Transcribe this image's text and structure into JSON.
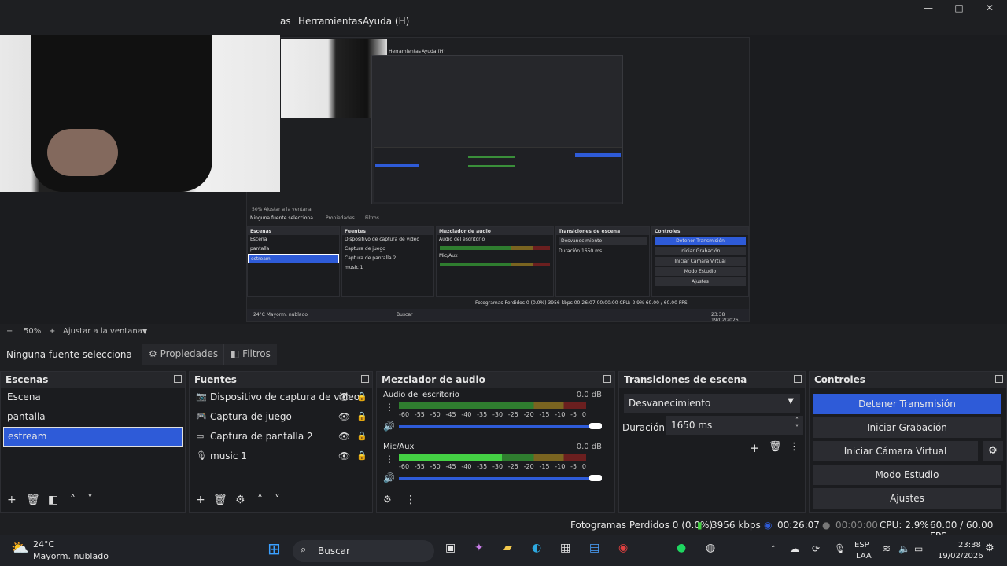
{
  "menu": {
    "items": [
      "as",
      "Herramientas",
      "Ayuda (H)"
    ]
  },
  "window_controls": {
    "minimize": "—",
    "maximize": "□",
    "close": "✕"
  },
  "preview": {
    "inner": {
      "menu": [
        "Herramientas",
        "Ayuda (H)"
      ],
      "status_left": "50%   Ajustar a la ventana",
      "no_source": "Ninguna fuente selecciona",
      "props": "Propiedades",
      "filters": "Filtros",
      "docks": {
        "scenes": {
          "title": "Escenas",
          "items": [
            "Escena",
            "pantalla",
            "estream"
          ]
        },
        "sources": {
          "title": "Fuentes",
          "items": [
            "Dispositivo de captura de video",
            "Captura de juego",
            "Captura de pantalla 2",
            "music 1"
          ]
        },
        "mixer": {
          "title": "Mezclador de audio",
          "ch1": "Audio del escritorio",
          "ch2": "Mic/Aux",
          "db": "0.0 dB"
        },
        "transitions": {
          "title": "Transiciones de escena",
          "value": "Desvanecimiento",
          "duration_label": "Duración",
          "duration": "1650 ms"
        },
        "controls": {
          "title": "Controles",
          "buttons": [
            "Detener Transmisión",
            "Iniciar Grabación",
            "Iniciar Cámara Virtual",
            "Modo Estudio",
            "Ajustes"
          ]
        }
      },
      "status": "Fotogramas Perdidos 0 (0.0%)   3956 kbps   00:26:07   00:00:00   CPU: 2.9%   60.00 / 60.00 FPS",
      "task_weather": "24°C Mayorm. nublado",
      "task_search": "Buscar",
      "task_clock": "23:38 19/02/2026"
    }
  },
  "zoom": {
    "minus": "−",
    "value": "50%",
    "plus": "+",
    "fit": "Ajustar a la ventana",
    "arrow": "▼"
  },
  "source_toolbar": {
    "no_source": "Ninguna fuente selecciona",
    "properties": "Propiedades",
    "filters": "Filtros"
  },
  "scenes": {
    "title": "Escenas",
    "items": [
      "Escena",
      "pantalla",
      "estream"
    ],
    "selected": 2
  },
  "sources": {
    "title": "Fuentes",
    "items": [
      {
        "icon": "camera-icon",
        "label": "Dispositivo de captura de video"
      },
      {
        "icon": "gamepad-icon",
        "label": "Captura de juego"
      },
      {
        "icon": "monitor-icon",
        "label": "Captura de pantalla 2"
      },
      {
        "icon": "microphone-icon",
        "label": "music 1"
      }
    ]
  },
  "mixer": {
    "title": "Mezclador de audio",
    "channels": [
      {
        "name": "Audio del escritorio",
        "db": "0.0 dB",
        "level": 0.0
      },
      {
        "name": "Mic/Aux",
        "db": "0.0 dB",
        "level": 0.55
      }
    ],
    "ticks": [
      "-60",
      "-55",
      "-50",
      "-45",
      "-40",
      "-35",
      "-30",
      "-25",
      "-20",
      "-15",
      "-10",
      "-5",
      "0"
    ]
  },
  "transitions": {
    "title": "Transiciones de escena",
    "value": "Desvanecimiento",
    "duration_label": "Duración",
    "duration": "1650 ms"
  },
  "controls": {
    "title": "Controles",
    "buttons": [
      "Detener Transmisión",
      "Iniciar Grabación",
      "Iniciar Cámara Virtual",
      "Modo Estudio",
      "Ajustes"
    ]
  },
  "status": {
    "dropped": "Fotogramas Perdidos 0 (0.0%)",
    "bitrate": "3956 kbps",
    "stream_time": "00:26:07",
    "rec_time": "00:00:00",
    "cpu": "CPU: 2.9%",
    "fps": "60.00 / 60.00 FPS"
  },
  "taskbar": {
    "weather_temp": "24°C",
    "weather_desc": "Mayorm. nublado",
    "search": "Buscar",
    "lang1": "ESP",
    "lang2": "LAA",
    "time": "23:38",
    "date": "19/02/2026"
  },
  "colors": {
    "accent": "#2e5bd8",
    "bg": "#1e1f22",
    "dock": "#1b1c1f",
    "meter_green": "#2f7d2f",
    "meter_yellow": "#7a6420",
    "meter_red": "#6b1f1f"
  }
}
